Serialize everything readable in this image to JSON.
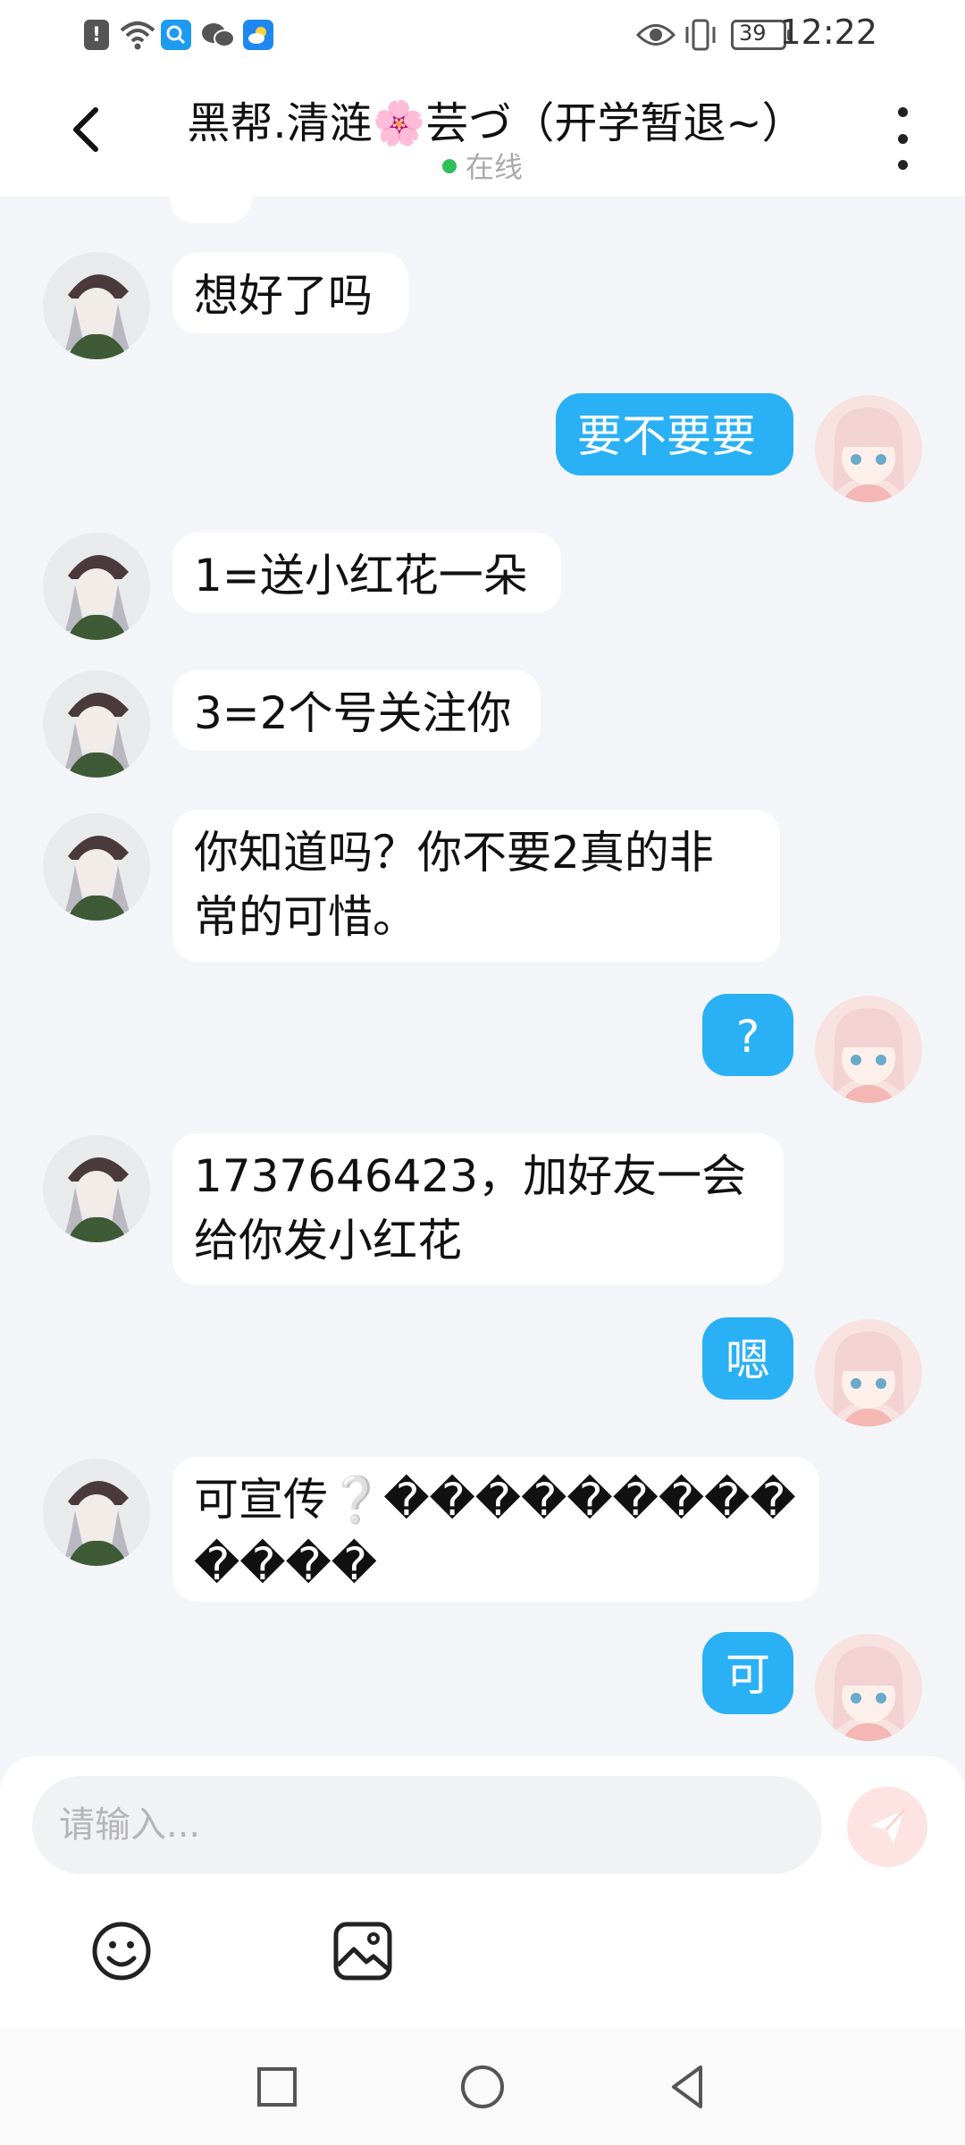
{
  "status_bar": {
    "time": "12:22",
    "battery": "39",
    "icons": [
      "alert-icon",
      "wifi-icon",
      "search-app-icon",
      "wechat-icon",
      "weather-app-icon",
      "eye-icon",
      "vibrate-icon",
      "battery-icon"
    ]
  },
  "header": {
    "title": "黑帮.清涟🌸芸づ（开学暂退~）",
    "presence": "在线",
    "presence_color": "#2ec05a"
  },
  "messages": [
    {
      "from": "other",
      "lines": [
        "想好了吗"
      ]
    },
    {
      "from": "me",
      "lines": [
        "要不要要"
      ]
    },
    {
      "from": "other",
      "lines": [
        "1=送小红花一朵"
      ]
    },
    {
      "from": "other",
      "lines": [
        "3=2个号关注你"
      ]
    },
    {
      "from": "other",
      "lines": [
        "你知道吗？你不要2真的非",
        "常的可惜。"
      ]
    },
    {
      "from": "me",
      "lines": [
        "?"
      ]
    },
    {
      "from": "other",
      "lines": [
        "1737646423，加好友一会",
        "给你发小红花"
      ]
    },
    {
      "from": "me",
      "lines": [
        "嗯"
      ]
    },
    {
      "from": "other",
      "lines": [
        "可宣传❔���������",
        "����"
      ]
    },
    {
      "from": "me",
      "lines": [
        "可"
      ]
    }
  ],
  "input": {
    "placeholder": "请输入..."
  },
  "colors": {
    "my_bubble": "#2ab0f4",
    "their_bubble": "#ffffff",
    "background": "#f3f5f8",
    "send_button": "#fde4e2"
  }
}
